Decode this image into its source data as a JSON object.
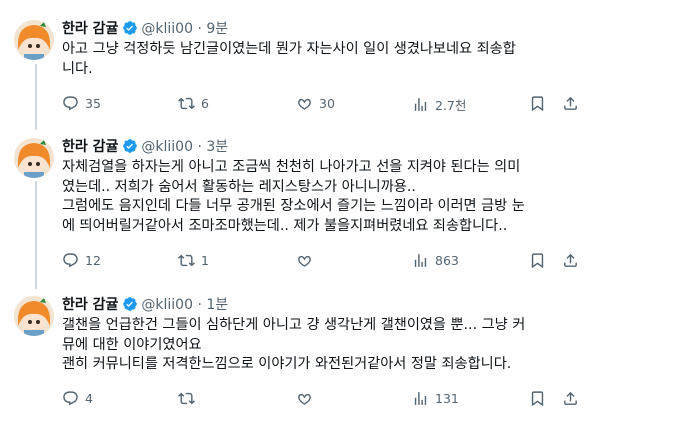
{
  "colors": {
    "text": "#0f1419",
    "muted": "#536471",
    "verified": "#1d9bf0",
    "thread_line": "#cfd9de"
  },
  "tweets": [
    {
      "name": "한라 감귤",
      "handle": "@klii00",
      "sep": "·",
      "time": "9분",
      "lines": [
        "아고 그냥 걱정하듯 남긴글이였는데 뭔가 자는사이 일이 생겼나보네요 죄송합",
        "니다."
      ],
      "replies": "35",
      "retweets": "6",
      "likes": "30",
      "views": "2.7천",
      "icons": [
        "reply-icon",
        "retweet-icon",
        "like-icon",
        "views-icon",
        "bookmark-icon",
        "share-icon"
      ]
    },
    {
      "name": "한라 감귤",
      "handle": "@klii00",
      "sep": "·",
      "time": "3분",
      "lines": [
        "자체검열을 하자는게 아니고 조금씩 천천히 나아가고 선을 지켜야 된다는 의미",
        "였는데.. 저희가 숨어서 활동하는 레지스탕스가 아니니까용..",
        "그럼에도 음지인데 다들 너무 공개된 장소에서 즐기는 느낌이라 이러면 금방 눈",
        "에 띄어버릴거같아서 조마조마했는데.. 제가 불을지펴버렸네요 죄송합니다.."
      ],
      "replies": "12",
      "retweets": "1",
      "likes": "",
      "views": "863"
    },
    {
      "name": "한라 감귤",
      "handle": "@klii00",
      "sep": "·",
      "time": "1분",
      "lines": [
        "갤챈을 언급한건 그들이 심하단게 아니고 걍 생각난게 갤챈이였을 뿐... 그냥 커",
        "뮤에 대한 이야기였어요",
        "괜히 커뮤니티를 저격한느낌으로 이야기가 와전된거같아서 정말 죄송합니다."
      ],
      "replies": "4",
      "retweets": "",
      "likes": "",
      "views": "131"
    }
  ]
}
